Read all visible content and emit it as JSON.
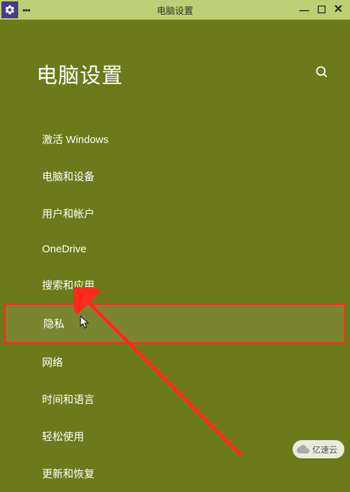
{
  "titlebar": {
    "title": "电脑设置",
    "dots": "•••"
  },
  "header": {
    "title": "电脑设置"
  },
  "menu": {
    "items": [
      {
        "label": "激活 Windows"
      },
      {
        "label": "电脑和设备"
      },
      {
        "label": "用户和帐户"
      },
      {
        "label": "OneDrive"
      },
      {
        "label": "搜索和应用"
      },
      {
        "label": "隐私"
      },
      {
        "label": "网络"
      },
      {
        "label": "时间和语言"
      },
      {
        "label": "轻松使用"
      },
      {
        "label": "更新和恢复"
      }
    ]
  },
  "watermark": {
    "text": "亿速云"
  }
}
